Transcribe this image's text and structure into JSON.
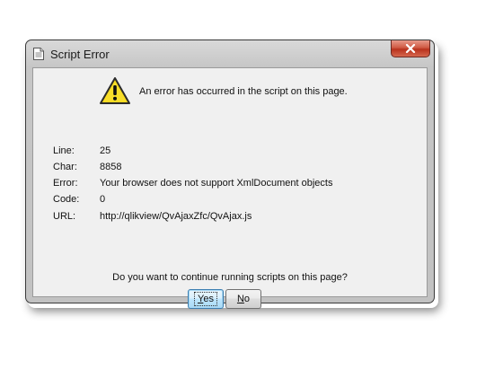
{
  "window": {
    "title": "Script Error"
  },
  "message": "An error has occurred in the script on this page.",
  "details": [
    {
      "label": "Line:",
      "value": "25"
    },
    {
      "label": "Char:",
      "value": "8858"
    },
    {
      "label": "Error:",
      "value": "Your browser does not support XmlDocument objects"
    },
    {
      "label": "Code:",
      "value": "0"
    },
    {
      "label": "URL:",
      "value": "http://qlikview/QvAjaxZfc/QvAjax.js"
    }
  ],
  "question": "Do you want to continue running scripts on this page?",
  "buttons": {
    "yes": {
      "accel": "Y",
      "rest": "es"
    },
    "no": {
      "accel": "N",
      "rest": "o"
    }
  },
  "icons": {
    "title": "document-icon",
    "warning": "warning-icon",
    "close": "close-icon"
  },
  "colors": {
    "close_button": "#c9452c",
    "warning_fill": "#f5d20e",
    "default_button_border": "#3c7fb1"
  }
}
